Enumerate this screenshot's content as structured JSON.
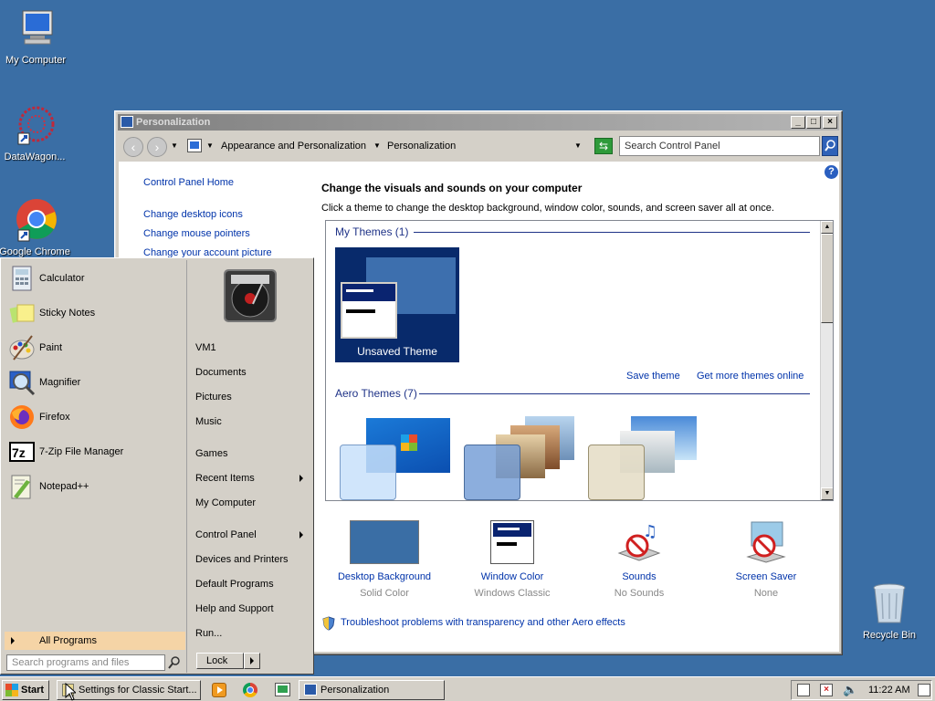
{
  "desktop": {
    "icons": [
      {
        "label": "My Computer"
      },
      {
        "label": "DataWagon..."
      },
      {
        "label": "Google Chrome"
      },
      {
        "label": "Recycle Bin"
      }
    ]
  },
  "window": {
    "title": "Personalization",
    "address": {
      "crumbs": [
        "Appearance and Personalization",
        "Personalization"
      ],
      "search_placeholder": "Search Control Panel"
    },
    "sidebar": {
      "home": "Control Panel Home",
      "links": [
        "Change desktop icons",
        "Change mouse pointers",
        "Change your account picture"
      ]
    },
    "main": {
      "heading": "Change the visuals and sounds on your computer",
      "subheading": "Click a theme to change the desktop background, window color, sounds, and screen saver all at once.",
      "my_themes_label": "My Themes (1)",
      "unsaved_theme": "Unsaved Theme",
      "save_theme": "Save theme",
      "get_more": "Get more themes online",
      "aero_label": "Aero Themes (7)"
    },
    "bottom": [
      {
        "title": "Desktop Background",
        "sub": "Solid Color"
      },
      {
        "title": "Window Color",
        "sub": "Windows Classic"
      },
      {
        "title": "Sounds",
        "sub": "No Sounds"
      },
      {
        "title": "Screen Saver",
        "sub": "None"
      }
    ],
    "troubleshoot": "Troubleshoot problems with transparency and other Aero effects"
  },
  "start_menu": {
    "programs": [
      "Calculator",
      "Sticky Notes",
      "Paint",
      "Magnifier",
      "Firefox",
      "7-Zip File Manager",
      "Notepad++"
    ],
    "all_programs": "All Programs",
    "search_placeholder": "Search programs and files",
    "right_items": [
      "VM1",
      "Documents",
      "Pictures",
      "Music",
      "Games",
      "Recent Items",
      "My Computer",
      "Control Panel",
      "Devices and Printers",
      "Default Programs",
      "Help and Support",
      "Run..."
    ],
    "lock": "Lock"
  },
  "taskbar": {
    "start": "Start",
    "tasks": [
      "Settings for Classic Start...",
      "Personalization"
    ],
    "clock": "11:22 AM"
  },
  "colors": {
    "desktop": "#3a6ea5",
    "link": "#0033aa",
    "section": "#1e3287"
  }
}
